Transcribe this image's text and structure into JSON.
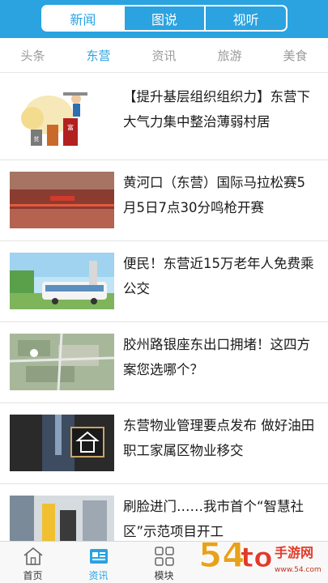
{
  "header": {
    "segments": [
      {
        "label": "新闻",
        "active": true
      },
      {
        "label": "图说",
        "active": false
      },
      {
        "label": "视听",
        "active": false
      }
    ]
  },
  "categories": [
    {
      "label": "头条",
      "active": false
    },
    {
      "label": "东营",
      "active": true
    },
    {
      "label": "资讯",
      "active": false
    },
    {
      "label": "旅游",
      "active": false
    },
    {
      "label": "美食",
      "active": false
    }
  ],
  "news": [
    {
      "title": "【提升基层组织组织力】东营下大气力集中整治薄弱村居",
      "thumb": "cartoon-illustration"
    },
    {
      "title": "黄河口（东营）国际马拉松赛5月5日7点30分鸣枪开赛",
      "thumb": "marathon-crowd-photo"
    },
    {
      "title": "便民！东营近15万老年人免费乘公交",
      "thumb": "bus-photo"
    },
    {
      "title": "胶州路银座东出口拥堵！这四方案您选哪个？",
      "thumb": "aerial-map"
    },
    {
      "title": "东营物业管理要点发布 做好油田职工家属区物业移交",
      "thumb": "house-chalkboard-photo"
    },
    {
      "title": "刷脸进门……我市首个“智慧社区”示范项目开工",
      "thumb": "gate-photo"
    }
  ],
  "tabbar": [
    {
      "label": "首页",
      "icon": "home-icon",
      "active": false
    },
    {
      "label": "资讯",
      "icon": "news-icon",
      "active": true
    },
    {
      "label": "模块",
      "icon": "grid-icon",
      "active": false
    }
  ],
  "colors": {
    "accent": "#2aa3e0"
  },
  "watermark": {
    "text": "54to手游网",
    "url": "www.54.com"
  }
}
